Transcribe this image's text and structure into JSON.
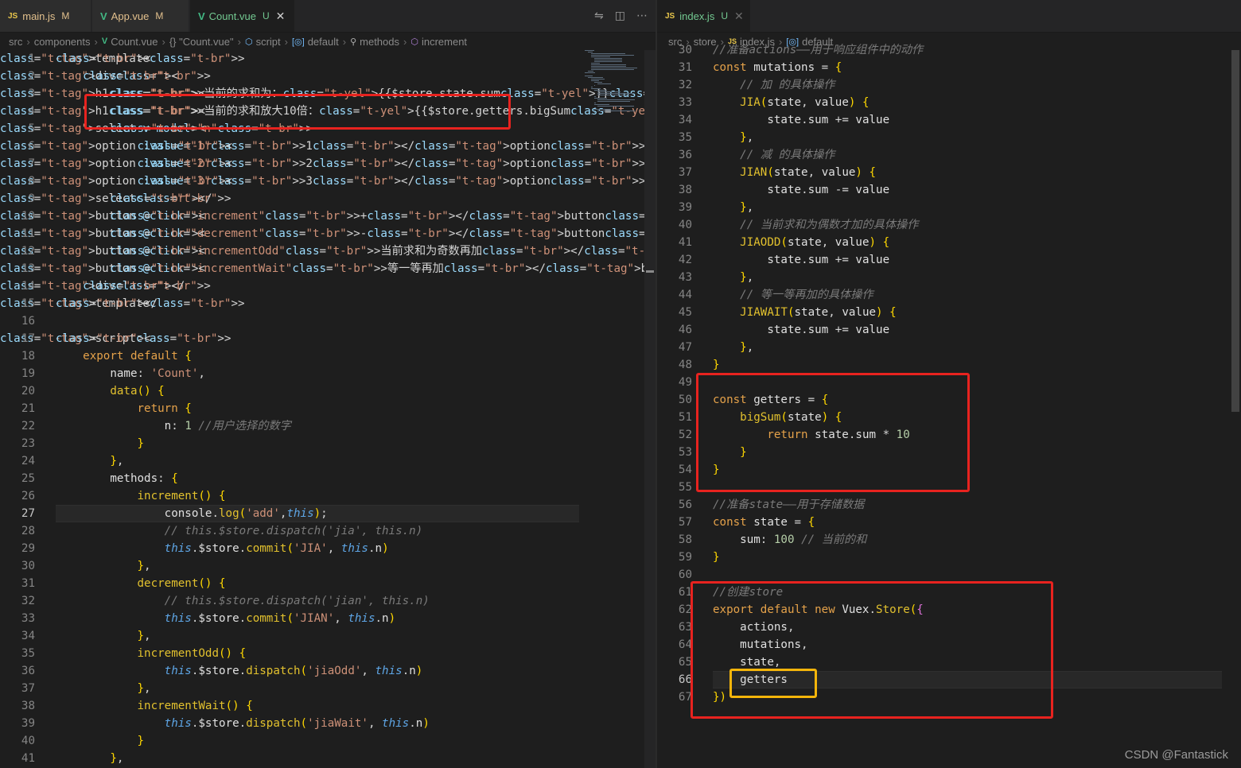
{
  "left_pane": {
    "tabs": [
      {
        "icon": "JS",
        "label": "main.js",
        "status": "M",
        "active": false
      },
      {
        "icon": "V",
        "label": "App.vue",
        "status": "M",
        "active": false
      },
      {
        "icon": "V",
        "label": "Count.vue",
        "status": "U",
        "active": true
      }
    ],
    "tab_actions": [
      "compare-icon",
      "split-editor-icon",
      "more-icon"
    ],
    "breadcrumb": [
      "src",
      "components",
      "Count.vue",
      "{} \"Count.vue\"",
      "script",
      "default",
      "methods",
      "increment"
    ],
    "current_line": 27,
    "lines": [
      "<template>",
      "    <div>",
      "        <h1>当前的求和为：{{$store.state.sum}}</h1>",
      "        <h1>当前的求和放大10倍：{{$store.getters.bigSum}}</h1>",
      "        <select v-model=\"n\">",
      "            <option :value=\"1\">1</option>",
      "            <option :value=\"2\">2</option>",
      "            <option :value=\"3\">3</option>",
      "        </select>",
      "        <button @click=\"increment\">+</button>",
      "        <button @click=\"decrement\">-</button>",
      "        <button @click=\"incrementOdd\">当前求和为奇数再加</button>",
      "        <button @click=\"incrementWait\">等一等再加</button>",
      "    </div>",
      "</template>",
      "",
      "<script>",
      "    export default {",
      "        name: 'Count',",
      "        data() {",
      "            return {",
      "                n: 1 //用户选择的数字",
      "            }",
      "        },",
      "        methods: {",
      "            increment() {",
      "                console.log('add',this);",
      "                // this.$store.dispatch('jia', this.n)",
      "                this.$store.commit('JIA', this.n)",
      "            },",
      "            decrement() {",
      "                // this.$store.dispatch('jian', this.n)",
      "                this.$store.commit('JIAN', this.n)",
      "            },",
      "            incrementOdd() {",
      "                this.$store.dispatch('jiaOdd', this.n)",
      "            },",
      "            incrementWait() {",
      "                this.$store.dispatch('jiaWait', this.n)",
      "            }",
      "        },"
    ]
  },
  "right_pane": {
    "tabs": [
      {
        "icon": "JS",
        "label": "index.js",
        "status": "U",
        "active": true
      }
    ],
    "breadcrumb": [
      "src",
      "store",
      "index.js",
      "default"
    ],
    "first_line_number": 30,
    "current_line": 66,
    "lines": [
      "//准备actions——用于响应组件中的动作",
      "const mutations = {",
      "    // 加 的具体操作",
      "    JIA(state, value) {",
      "        state.sum += value",
      "    },",
      "    // 减 的具体操作",
      "    JIAN(state, value) {",
      "        state.sum -= value",
      "    },",
      "    // 当前求和为偶数才加的具体操作",
      "    JIAODD(state, value) {",
      "        state.sum += value",
      "    },",
      "    // 等一等再加的具体操作",
      "    JIAWAIT(state, value) {",
      "        state.sum += value",
      "    },",
      "}",
      "",
      "const getters = {",
      "    bigSum(state) {",
      "        return state.sum * 10",
      "    }",
      "}",
      "",
      "//准备state——用于存储数据",
      "const state = {",
      "    sum: 100 // 当前的和",
      "}",
      "",
      "//创建store",
      "export default new Vuex.Store({",
      "    actions,",
      "    mutations,",
      "    state,",
      "    getters",
      "})"
    ]
  },
  "watermark": "CSDN @Fantastick",
  "colors": {
    "editor_bg": "#1e1e1e",
    "highlight_red": "#e8231f",
    "highlight_yellow": "#f5b50a",
    "js_icon": "#e8c64b",
    "vue_icon": "#42b883",
    "modified_status": "#e2c08d",
    "untracked_status": "#73c991"
  }
}
